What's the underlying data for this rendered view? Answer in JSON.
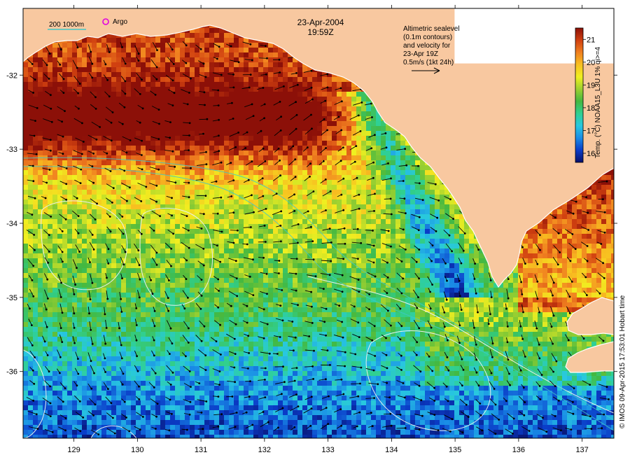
{
  "header": {
    "date": "23-Apr-2004",
    "time": "19:59Z"
  },
  "legend": {
    "bathymetry_label": "200  1000m",
    "argo_label": "Argo",
    "argo_marker_color": "#e000e0",
    "bathy_line_color": "#40c8c8"
  },
  "annotation": {
    "lines": [
      "Altimetric sealevel",
      "(0.1m contours)",
      "and velocity for",
      "23-Apr 19Z",
      "0.5m/s (1kt 24h)"
    ]
  },
  "colorbar": {
    "title": "Temp. (°C) NOAA15_L3U 1% qi>=4",
    "ticks": [
      "21",
      "20",
      "19",
      "18",
      "17",
      "16"
    ],
    "min": 15.6,
    "max": 21.5,
    "colors": [
      "#08106a",
      "#0a3cc8",
      "#1a8ce6",
      "#28c8e0",
      "#30d090",
      "#44b840",
      "#9cd030",
      "#f0f020",
      "#f8c020",
      "#f08020",
      "#d04010",
      "#8c1008"
    ]
  },
  "axes": {
    "x_ticks": [
      "129",
      "130",
      "131",
      "132",
      "133",
      "134",
      "135",
      "136",
      "137"
    ],
    "y_ticks": [
      "-32",
      "-33",
      "-34",
      "-35",
      "-36"
    ],
    "lon_range": [
      128.2,
      137.5
    ],
    "lat_range": [
      -31.1,
      -36.9
    ]
  },
  "colors": {
    "land": "#f8c8a0",
    "contour": "#e8f0f0",
    "arrow": "#000000"
  },
  "credit": "© IMOS 09-Apr-2015 17:53:01 Hobart time"
}
